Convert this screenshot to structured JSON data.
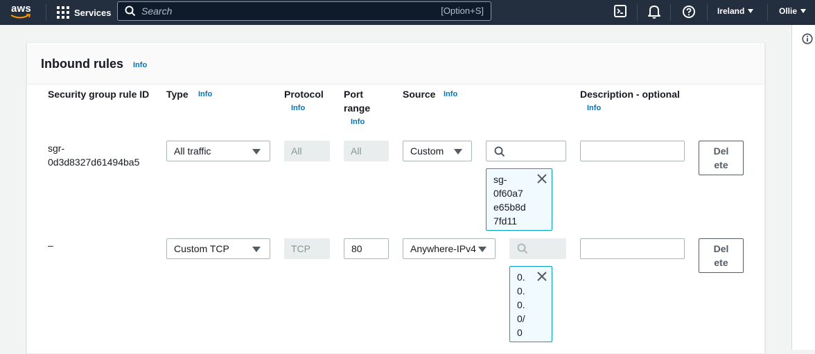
{
  "nav": {
    "logo": "aws",
    "services_label": "Services",
    "search_placeholder": "Search",
    "search_shortcut": "[Option+S]",
    "region_label": "Ireland",
    "user_label": "Ollie"
  },
  "panel": {
    "title": "Inbound rules",
    "info": "Info"
  },
  "columns": {
    "rule_id": "Security group rule ID",
    "type": "Type",
    "protocol": "Protocol",
    "port_line1": "Port",
    "port_line2": "range",
    "source": "Source",
    "description": "Description - optional",
    "info": "Info"
  },
  "rows": [
    {
      "rule_id_line1": "sgr-",
      "rule_id_line2": "0d3d8327d61494ba5",
      "type": "All traffic",
      "protocol": "All",
      "port": "All",
      "source": "Custom",
      "search_value": "",
      "token_lines": [
        "sg-",
        "0f60a7",
        "e65b8d",
        "7fd11"
      ],
      "description": "",
      "delete_line1": "Del",
      "delete_line2": "ete"
    },
    {
      "rule_id_line1": "–",
      "type": "Custom TCP",
      "protocol": "TCP",
      "port": "80",
      "source": "Anywhere-IPv4",
      "search_value": "",
      "token_lines": [
        "0.",
        "0.",
        "0.",
        "0/",
        "0"
      ],
      "description": "",
      "delete_line1": "Del",
      "delete_line2": "ete"
    }
  ]
}
